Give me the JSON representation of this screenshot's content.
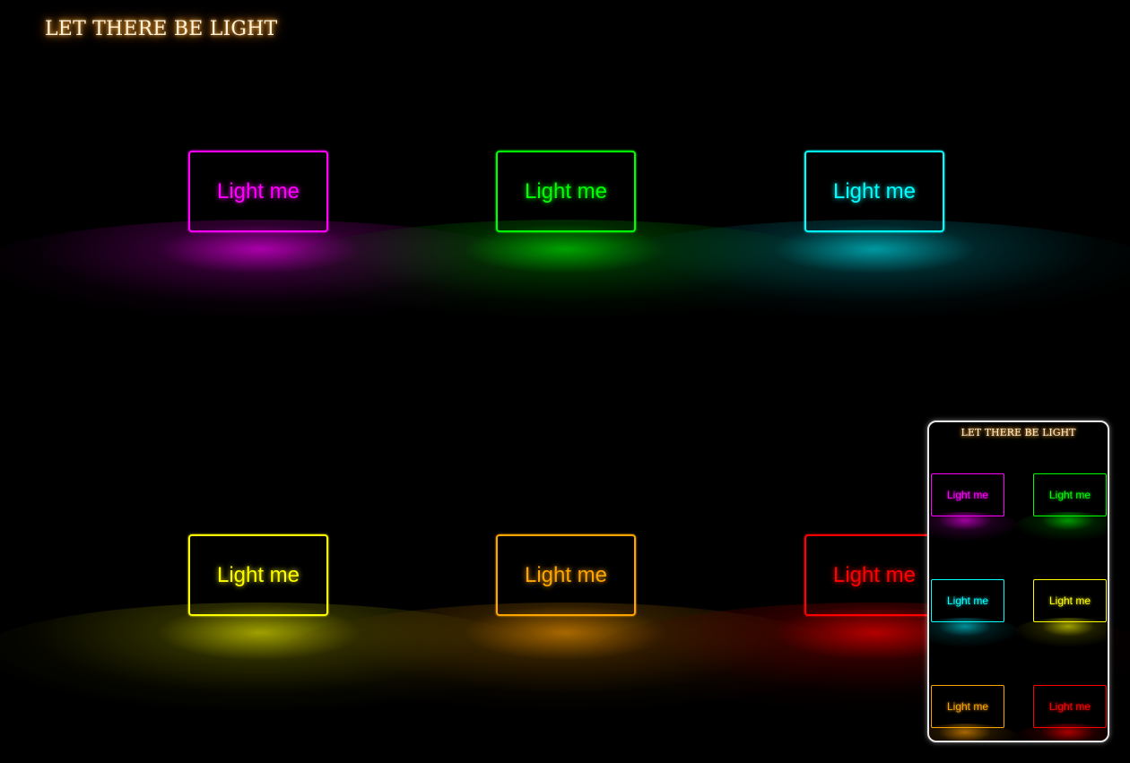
{
  "title": "LET THERE BE LIGHT",
  "buttons": [
    {
      "label": "Light me",
      "color": "#ff00ff",
      "glow": "rgba(200,0,200,0.85)"
    },
    {
      "label": "Light me",
      "color": "#00ff00",
      "glow": "rgba(0,190,0,0.85)"
    },
    {
      "label": "Light me",
      "color": "#00ffff",
      "glow": "rgba(0,180,190,0.85)"
    },
    {
      "label": "Light me",
      "color": "#ffff00",
      "glow": "rgba(200,200,0,0.8)"
    },
    {
      "label": "Light me",
      "color": "#ffa500",
      "glow": "rgba(210,130,0,0.8)"
    },
    {
      "label": "Light me",
      "color": "#ff0000",
      "glow": "rgba(210,0,0,0.85)"
    }
  ],
  "preview": {
    "title": "LET THERE BE LIGHT",
    "buttons": [
      {
        "label": "Light me",
        "color": "#ff00ff"
      },
      {
        "label": "Light me",
        "color": "#00ff00"
      },
      {
        "label": "Light me",
        "color": "#00ffff"
      },
      {
        "label": "Light me",
        "color": "#ffff00"
      },
      {
        "label": "Light me",
        "color": "#ffa500"
      },
      {
        "label": "Light me",
        "color": "#ff0000"
      }
    ]
  }
}
